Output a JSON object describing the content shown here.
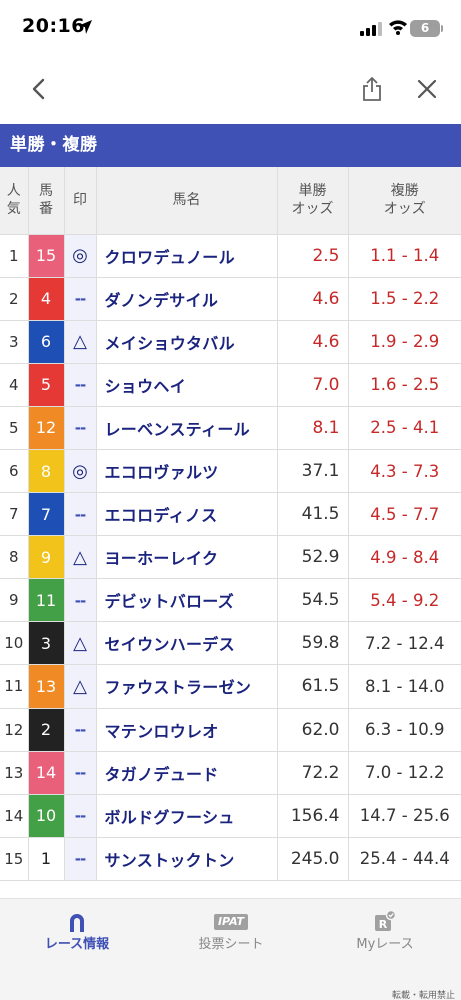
{
  "status": {
    "time": "20:16",
    "battery": "6"
  },
  "section_title": "単勝・複勝",
  "table": {
    "headers": {
      "popularity": [
        "人",
        "気"
      ],
      "number": [
        "馬",
        "番"
      ],
      "mark": "印",
      "name": "馬名",
      "win": [
        "単勝",
        "オッズ"
      ],
      "place": [
        "複勝",
        "オッズ"
      ]
    },
    "rows": [
      {
        "pop": "1",
        "num": "15",
        "num_bg": "#e8607a",
        "mark": "◎",
        "name": "クロワデュノール",
        "win": "2.5",
        "place": "1.1 - 1.4",
        "win_red": true,
        "place_red": true
      },
      {
        "pop": "2",
        "num": "4",
        "num_bg": "#e53935",
        "mark": "--",
        "name": "ダノンデサイル",
        "win": "4.6",
        "place": "1.5 - 2.2",
        "win_red": true,
        "place_red": true
      },
      {
        "pop": "3",
        "num": "6",
        "num_bg": "#1e4fb5",
        "mark": "△",
        "name": "メイショウタバル",
        "win": "4.6",
        "place": "1.9 - 2.9",
        "win_red": true,
        "place_red": true
      },
      {
        "pop": "4",
        "num": "5",
        "num_bg": "#e53935",
        "mark": "--",
        "name": "ショウヘイ",
        "win": "7.0",
        "place": "1.6 - 2.5",
        "win_red": true,
        "place_red": true
      },
      {
        "pop": "5",
        "num": "12",
        "num_bg": "#f08a24",
        "mark": "--",
        "name": "レーベンスティール",
        "win": "8.1",
        "place": "2.5 - 4.1",
        "win_red": true,
        "place_red": true
      },
      {
        "pop": "6",
        "num": "8",
        "num_bg": "#f2c31b",
        "mark": "◎",
        "name": "エコロヴァルツ",
        "win": "37.1",
        "place": "4.3 - 7.3",
        "win_red": false,
        "place_red": true
      },
      {
        "pop": "7",
        "num": "7",
        "num_bg": "#1e4fb5",
        "mark": "--",
        "name": "エコロディノス",
        "win": "41.5",
        "place": "4.5 - 7.7",
        "win_red": false,
        "place_red": true
      },
      {
        "pop": "8",
        "num": "9",
        "num_bg": "#f2c31b",
        "mark": "△",
        "name": "ヨーホーレイク",
        "win": "52.9",
        "place": "4.9 - 8.4",
        "win_red": false,
        "place_red": true
      },
      {
        "pop": "9",
        "num": "11",
        "num_bg": "#43a047",
        "mark": "--",
        "name": "デビットバローズ",
        "win": "54.5",
        "place": "5.4 - 9.2",
        "win_red": false,
        "place_red": true
      },
      {
        "pop": "10",
        "num": "3",
        "num_bg": "#222222",
        "mark": "△",
        "name": "セイウンハーデス",
        "win": "59.8",
        "place": "7.2 - 12.4",
        "win_red": false,
        "place_red": false
      },
      {
        "pop": "11",
        "num": "13",
        "num_bg": "#f08a24",
        "mark": "△",
        "name": "ファウストラーゼン",
        "win": "61.5",
        "place": "8.1 - 14.0",
        "win_red": false,
        "place_red": false
      },
      {
        "pop": "12",
        "num": "2",
        "num_bg": "#222222",
        "mark": "--",
        "name": "マテンロウレオ",
        "win": "62.0",
        "place": "6.3 - 10.9",
        "win_red": false,
        "place_red": false
      },
      {
        "pop": "13",
        "num": "14",
        "num_bg": "#e8607a",
        "mark": "--",
        "name": "タガノデュード",
        "win": "72.2",
        "place": "7.0 - 12.2",
        "win_red": false,
        "place_red": false
      },
      {
        "pop": "14",
        "num": "10",
        "num_bg": "#43a047",
        "mark": "--",
        "name": "ボルドグフーシュ",
        "win": "156.4",
        "place": "14.7 - 25.6",
        "win_red": false,
        "place_red": false
      },
      {
        "pop": "15",
        "num": "1",
        "num_bg": "#ffffff",
        "mark": "--",
        "name": "サンストックトン",
        "win": "245.0",
        "place": "25.4 - 44.4",
        "win_red": false,
        "place_red": false
      }
    ]
  },
  "tabs": [
    {
      "label": "レース情報",
      "icon": "horseshoe-icon",
      "active": true
    },
    {
      "label": "投票シート",
      "icon": "ipat-icon",
      "badge": "IPAT",
      "active": false
    },
    {
      "label": "Myレース",
      "icon": "my-race-icon",
      "active": false
    }
  ],
  "footer_note": "転載・転用禁止",
  "colors": {
    "accent": "#3f51b5",
    "red": "#c62828",
    "name_text": "#1a237e"
  }
}
